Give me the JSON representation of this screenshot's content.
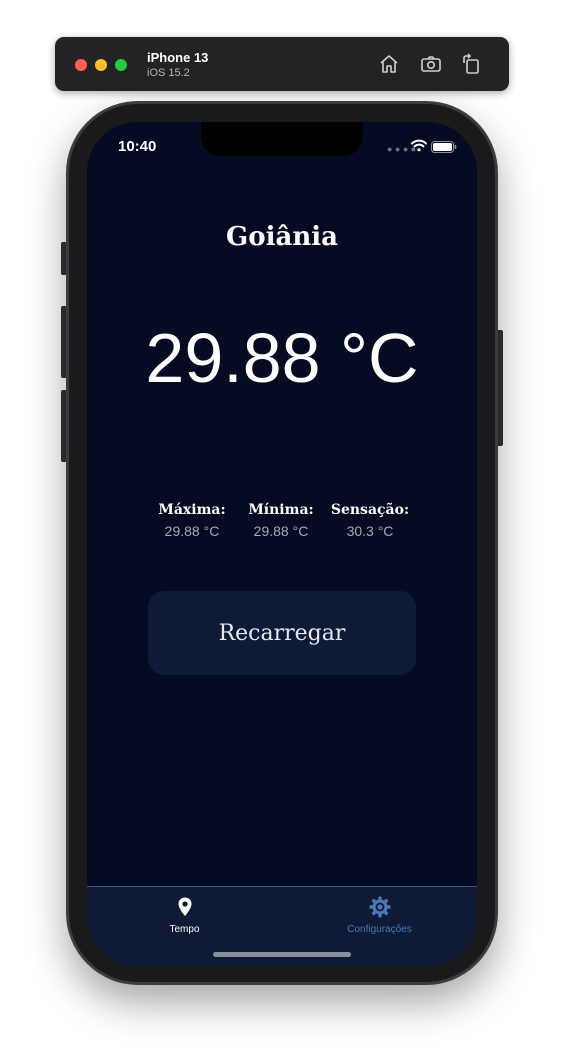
{
  "simulator": {
    "device_name": "iPhone 13",
    "os_version": "iOS 15.2",
    "buttons": [
      "home-icon",
      "screenshot-icon",
      "rotate-icon"
    ]
  },
  "status_bar": {
    "time": "10:40",
    "icons": [
      "signal-dots-icon",
      "wifi-icon",
      "battery-icon"
    ]
  },
  "weather": {
    "city": "Goiânia",
    "temperature": "29.88 °C",
    "stats": [
      {
        "label": "Máxima:",
        "value": "29.88 °C"
      },
      {
        "label": "Mínima:",
        "value": "29.88 °C"
      },
      {
        "label": "Sensação:",
        "value": "30.3 °C"
      }
    ],
    "reload_label": "Recarregar"
  },
  "tab_bar": {
    "tabs": [
      {
        "label": "Tempo",
        "icon": "location-pin-icon",
        "active": true
      },
      {
        "label": "Configurações",
        "icon": "gear-icon",
        "active": false
      }
    ]
  },
  "colors": {
    "background": "#040b22",
    "surface": "#0f1a37",
    "accent_inactive": "#4f78b6",
    "text": "#ffffff"
  }
}
